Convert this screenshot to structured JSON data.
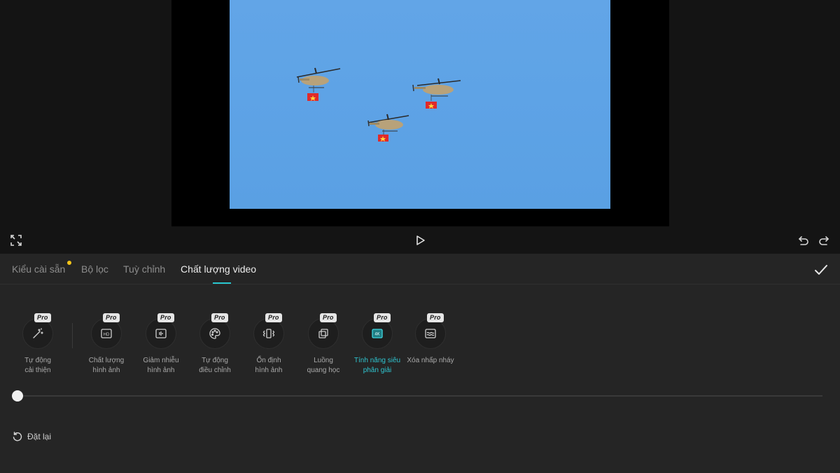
{
  "preview": {
    "image_subject": "three helicopters with flags in blue sky"
  },
  "controls": {
    "fullscreen_icon": "expand-icon",
    "play_icon": "play-icon",
    "undo_icon": "undo-icon",
    "redo_icon": "redo-icon"
  },
  "tabs": [
    {
      "label": "Kiểu cài sẵn",
      "active": false,
      "has_dot": true
    },
    {
      "label": "Bộ lọc",
      "active": false
    },
    {
      "label": "Tuỳ chỉnh",
      "active": false
    },
    {
      "label": "Chất lượng video",
      "active": true
    }
  ],
  "confirm_icon": "checkmark-icon",
  "tools": [
    {
      "label": "Tự động\ncải thiện",
      "badge": "Pro",
      "icon": "magic-wand-icon"
    },
    {
      "label": "Chất lượng\nhình ảnh",
      "badge": "Pro",
      "icon": "hd-icon"
    },
    {
      "label": "Giảm nhiễu\nhình ảnh",
      "badge": "Pro",
      "icon": "denoise-icon"
    },
    {
      "label": "Tự động\nđiều chỉnh",
      "badge": "Pro",
      "icon": "palette-icon"
    },
    {
      "label": "Ổn định\nhình ảnh",
      "badge": "Pro",
      "icon": "stabilize-icon"
    },
    {
      "label": "Luồng\nquang học",
      "badge": "Pro",
      "icon": "optical-flow-icon"
    },
    {
      "label": "Tính năng siêu\nphân giải",
      "badge": "Pro",
      "icon": "4k-icon",
      "selected": true
    },
    {
      "label": "Xóa nhấp nháy",
      "badge": "Pro",
      "icon": "flicker-icon"
    }
  ],
  "slider": {
    "value": 0
  },
  "reset": {
    "label": "Đặt lại",
    "icon": "reset-icon"
  },
  "colors": {
    "accent": "#27c6cf",
    "notification_dot": "#f5c518",
    "panel_bg": "#252525",
    "sky": "#5ea3e6"
  }
}
